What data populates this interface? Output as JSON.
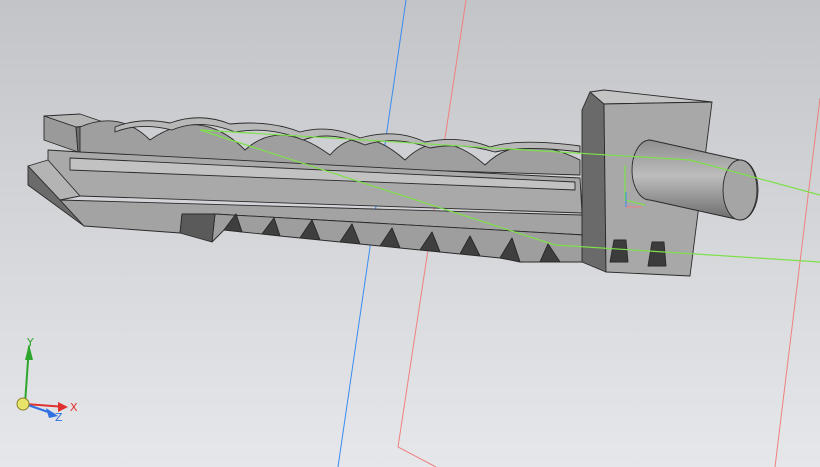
{
  "viewport": {
    "background_top": "#c2c4c8",
    "background_bottom": "#e6e7ea"
  },
  "model": {
    "part": "rack-and-cylinder-assembly",
    "teeth_count": 11,
    "lobes_count": 5,
    "face_color": "#a7a7a7",
    "side_color": "#6f6f6f",
    "top_color": "#b9b9b9",
    "edge_color": "#2a2a2a"
  },
  "overlay_lines": {
    "blue_axis_color": "#3a8cf0",
    "red_plane_color": "#f08080",
    "sketch_color": "#7ee04a"
  },
  "triad": {
    "x_label": "X",
    "y_label": "Y",
    "z_label": "Z",
    "x_color": "#e03030",
    "y_color": "#2ea62e",
    "z_color": "#3070e0"
  }
}
